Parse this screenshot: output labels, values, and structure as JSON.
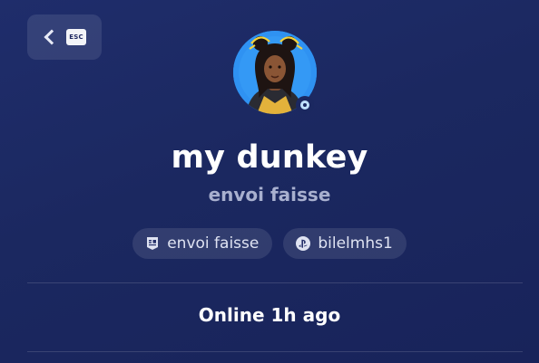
{
  "back": {
    "key_label": "ESC"
  },
  "profile": {
    "display_name": "my dunkey",
    "sub_name": "envoi faisse",
    "presence": "Online 1h ago"
  },
  "accounts": [
    {
      "platform": "epic-games-icon",
      "name": "envoi faisse"
    },
    {
      "platform": "playstation-icon",
      "name": "bilelmhs1"
    }
  ],
  "colors": {
    "background": "#1b2860",
    "status_ring": "#bfe0ff",
    "avatar_bg": "#2d8ff0"
  }
}
